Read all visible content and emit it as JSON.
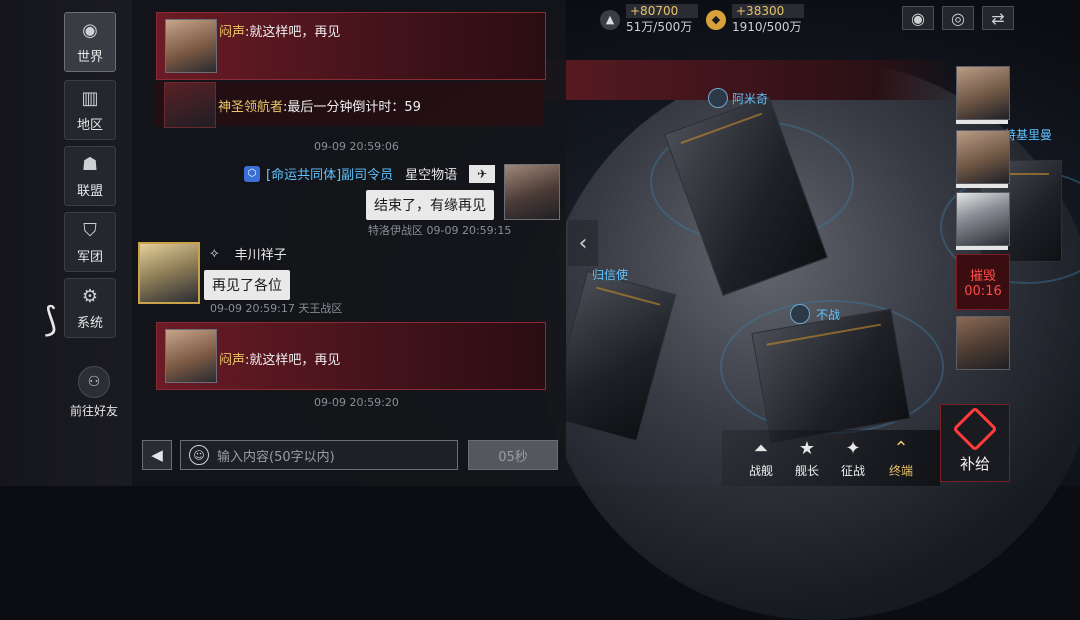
{
  "nav": {
    "items": [
      {
        "label": "世界",
        "icon": "globe-icon"
      },
      {
        "label": "地区",
        "icon": "buildings-icon"
      },
      {
        "label": "联盟",
        "icon": "people-icon"
      },
      {
        "label": "军团",
        "icon": "shield-icon"
      },
      {
        "label": "系统",
        "icon": "gear-icon"
      }
    ],
    "friends_label": "前往好友"
  },
  "chat": {
    "top_msg": {
      "name": "闷声",
      "text": ":就这样吧，再见"
    },
    "countdown_msg": {
      "name": "神圣领航者",
      "text": ":最后一分钟倒计时：59"
    },
    "ts1": "09-09 20:59:06",
    "msg_right": {
      "guild": "[命运共同体]副司令员",
      "name": "星空物语",
      "text": "结束了，有缘再见",
      "meta": "特洛伊战区 09-09 20:59:15"
    },
    "msg_left": {
      "name": "丰川祥子",
      "text": "再见了各位",
      "meta": "09-09 20:59:17 天王战区"
    },
    "bottom_msg": {
      "name": "闷声",
      "text": ":就这样吧，再见"
    },
    "ts2": "09-09 20:59:20",
    "input_placeholder": "输入内容(50字以内)",
    "send_label": "05秒"
  },
  "topbar": {
    "res1_gain": "+80700",
    "res1_total": "51万/500万",
    "res2_gain": "+38300",
    "res2_total": "1910/500万"
  },
  "map": {
    "labels": {
      "amiqi": "阿米奇",
      "teji": "特基里曼",
      "buzhan": "不战",
      "guixin": "归信使"
    },
    "timer_title": "摧毁",
    "timer_value": "00:16"
  },
  "bottom": {
    "buttons": [
      {
        "label": "战舰",
        "icon": "ship-icon"
      },
      {
        "label": "舰长",
        "icon": "rank-icon"
      },
      {
        "label": "征战",
        "icon": "wings-icon"
      },
      {
        "label": "终端",
        "icon": "terminal-icon"
      }
    ],
    "supply_label": "补给"
  },
  "colors": {
    "accent_red": "#8a2a35",
    "gold": "#e9c46a",
    "blue": "#5fc4ff"
  }
}
